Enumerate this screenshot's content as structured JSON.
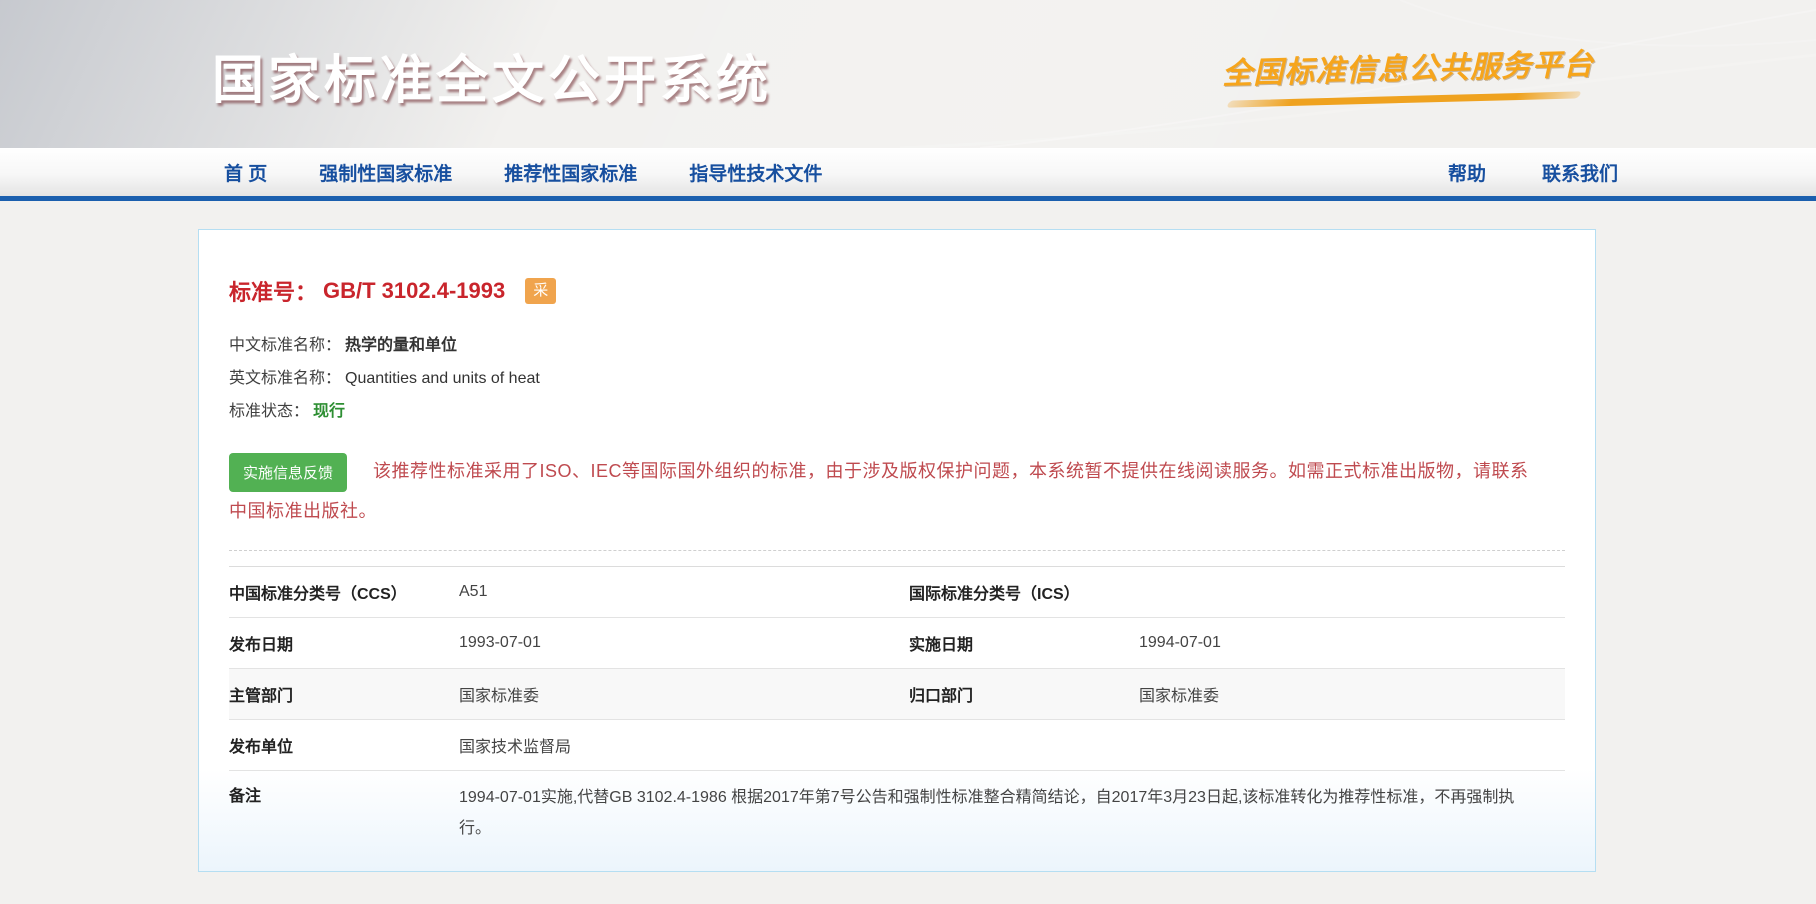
{
  "header": {
    "title": "国家标准全文公开系统",
    "platform_logo": "全国标准信息公共服务平台"
  },
  "nav": {
    "items": [
      {
        "label": "首 页"
      },
      {
        "label": "强制性国家标准"
      },
      {
        "label": "推荐性国家标准"
      },
      {
        "label": "指导性技术文件"
      }
    ],
    "right_items": [
      {
        "label": "帮助"
      },
      {
        "label": "联系我们"
      }
    ]
  },
  "detail": {
    "standard_no_label": "标准号：",
    "standard_no": "GB/T 3102.4-1993",
    "adopted_badge": "采",
    "cn_name_label": "中文标准名称：",
    "cn_name": "热学的量和单位",
    "en_name_label": "英文标准名称：",
    "en_name": "Quantities and units of heat",
    "status_label": "标准状态：",
    "status": "现行",
    "feedback_button": "实施信息反馈",
    "notice": "该推荐性标准采用了ISO、IEC等国际国外组织的标准，由于涉及版权保护问题，本系统暂不提供在线阅读服务。如需正式标准出版物，请联系中国标准出版社。"
  },
  "table": {
    "ccs_label": "中国标准分类号（CCS）",
    "ccs_value": "A51",
    "ics_label": "国际标准分类号（ICS）",
    "ics_value": "",
    "pub_date_label": "发布日期",
    "pub_date": "1993-07-01",
    "impl_date_label": "实施日期",
    "impl_date": "1994-07-01",
    "admin_dept_label": "主管部门",
    "admin_dept": "国家标准委",
    "centralized_dept_label": "归口部门",
    "centralized_dept": "国家标准委",
    "issuing_unit_label": "发布单位",
    "issuing_unit": "国家技术监督局",
    "remarks_label": "备注",
    "remarks": "1994-07-01实施,代替GB 3102.4-1986 根据2017年第7号公告和强制性标准整合精简结论，自2017年3月23日起,该标准转化为推荐性标准，不再强制执行。"
  },
  "colors": {
    "header_blue": "#2e75bb",
    "nav_link_blue": "#174f9f",
    "accent_line_blue": "#1b5fae",
    "standard_no_red": "#c9252c",
    "badge_orange": "#f0a44d",
    "status_green": "#2e8f33",
    "feedback_button_green": "#52b153",
    "notice_red": "#bf4a4f",
    "logo_orange": "#f6a51c"
  }
}
